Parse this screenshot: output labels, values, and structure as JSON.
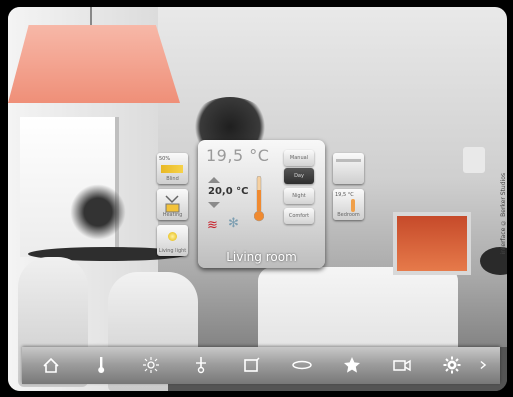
{
  "main_panel": {
    "current_temperature": "19,5 °C",
    "setpoint": "20,0 °C",
    "room_name": "Living room",
    "modes": [
      "Manual",
      "Day",
      "Night",
      "Comfort"
    ],
    "active_mode": "Day"
  },
  "left_tiles": [
    {
      "top_text": "50%",
      "caption": "Blind"
    },
    {
      "top_text": "",
      "caption": "Heating"
    },
    {
      "top_text": "",
      "caption": "Living light"
    }
  ],
  "right_tiles": [
    {
      "top_text": "",
      "caption": ""
    },
    {
      "top_text": "19,5 °C",
      "caption": "Bedroom"
    }
  ],
  "navbar": {
    "items": [
      "home-icon",
      "temperature-icon",
      "light-icon",
      "switch-icon",
      "blinds-icon",
      "scene-icon",
      "favorite-icon",
      "camera-icon",
      "settings-icon",
      "next-arrow-icon"
    ]
  },
  "credit": "interface © Berker Studios",
  "colors": {
    "heat": "#c8202a",
    "cool": "#7d9fb2",
    "lamp": "#ef8f78"
  }
}
